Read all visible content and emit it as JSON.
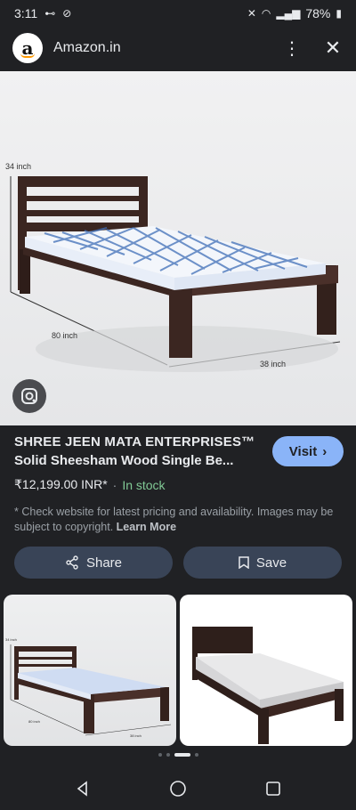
{
  "status": {
    "time": "3:11",
    "battery": "78%"
  },
  "header": {
    "site": "Amazon.in",
    "logo_letter": "a"
  },
  "hero": {
    "dim_height": "34 inch",
    "dim_length": "80 inch",
    "dim_width": "38 inch"
  },
  "product": {
    "title_line1": "SHREE JEEN MATA ENTERPRISES™",
    "title_line2": "Solid Sheesham Wood Single Be...",
    "price": "₹12,199.00 INR*",
    "separator": "·",
    "stock": "In stock",
    "visit_label": "Visit",
    "note": "* Check website for latest pricing and availability. Images may be subject to copyright.",
    "learn_more": "Learn More"
  },
  "actions": {
    "share_label": "Share",
    "save_label": "Save"
  },
  "thumbs": {
    "t1_dim_h": "34 inch",
    "t1_dim_l": "80 inch",
    "t1_dim_w": "38 inch"
  },
  "colors": {
    "accent": "#8ab4f8",
    "stock": "#81c995",
    "wood": "#3b2621"
  }
}
